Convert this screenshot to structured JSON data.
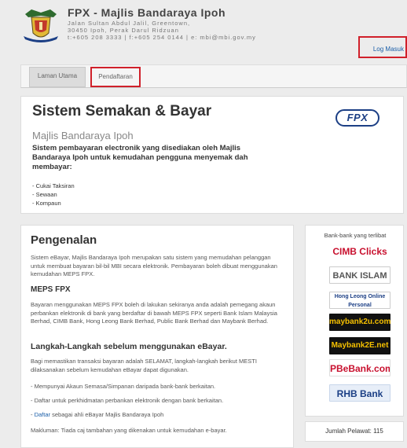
{
  "header": {
    "title": "FPX - Majlis Bandaraya Ipoh",
    "address_1": "Jalan Sultan Abdul Jalil, Greentown,",
    "address_2": "30450 Ipoh, Perak Darul Ridzuan",
    "address_3": "t:+605 208 3333 | f:+605 254 0144 | e: mbi@mbi.gov.my",
    "login_label": "Log Masuk"
  },
  "nav": {
    "tabs": [
      {
        "label": "Laman Utama"
      },
      {
        "label": "Pendaftaran"
      }
    ]
  },
  "hero": {
    "title": "Sistem Semakan & Bayar",
    "subtitle": "Majlis Bandaraya Ipoh",
    "description": "Sistem pembayaran electronik yang disediakan oleh Majlis Bandaraya Ipoh untuk kemudahan pengguna menyemak dah membayar:",
    "items": [
      "- Cukai Taksiran",
      "- Sewaan",
      "- Kompaun"
    ],
    "logo_text": "FPX"
  },
  "intro": {
    "title": "Pengenalan",
    "para_1": "Sistem eBayar, Majlis Bandaraya Ipoh merupakan satu sistem yang memudahan pelanggan untuk membuat bayaran bil-bil MBI secara elektronik. Pembayaran boleh dibuat menggunakan kemudahan MEPS FPX.",
    "meps_title": "MEPS FPX",
    "para_2": "Bayaran menggunakan MEPS FPX boleh di lakukan sekiranya anda adalah pemegang akaun perbankan elektronik di bank yang berdaftar di bawah MEPS FPX seperti Bank Islam Malaysia Berhad, CIMB Bank, Hong Leong Bank Berhad, Public Bank Berhad dan Maybank Berhad.",
    "steps_title": "Langkah-Langkah sebelum menggunakan eBayar.",
    "para_3": "Bagi memastikan transaksi bayaran adalah SELAMAT, langkah-langkah berikut MESTI dilaksanakan sebelum kemudahan eBayar dapat digunakan.",
    "step_1": "- Mempunyai Akaun Semasa/Simpanan daripada bank-bank berkaitan.",
    "step_2": "- Daftar untuk perkhidmatan perbankan elektronik dengan bank berkaitan.",
    "step_3_prefix": "- ",
    "step_3_link": "Daftar",
    "step_3_suffix": " sebagai ahli eBayar Majlis Bandaraya Ipoh",
    "note": "Makluman: Tiada caj tambahan yang dikenakan untuk kemudahan e-bayar."
  },
  "banks": {
    "title": "Bank-bank yang terlibat",
    "list": [
      {
        "name": "CIMB Clicks"
      },
      {
        "name": "BANK ISLAM"
      },
      {
        "name": "Hong Leong Online Personal"
      },
      {
        "name": "maybank2u.com"
      },
      {
        "name": "Maybank2E.net"
      },
      {
        "name": "PBeBank.com"
      },
      {
        "name": "RHB Bank"
      }
    ]
  },
  "visitors": {
    "label": "Jumlah Pelawat: 115"
  }
}
